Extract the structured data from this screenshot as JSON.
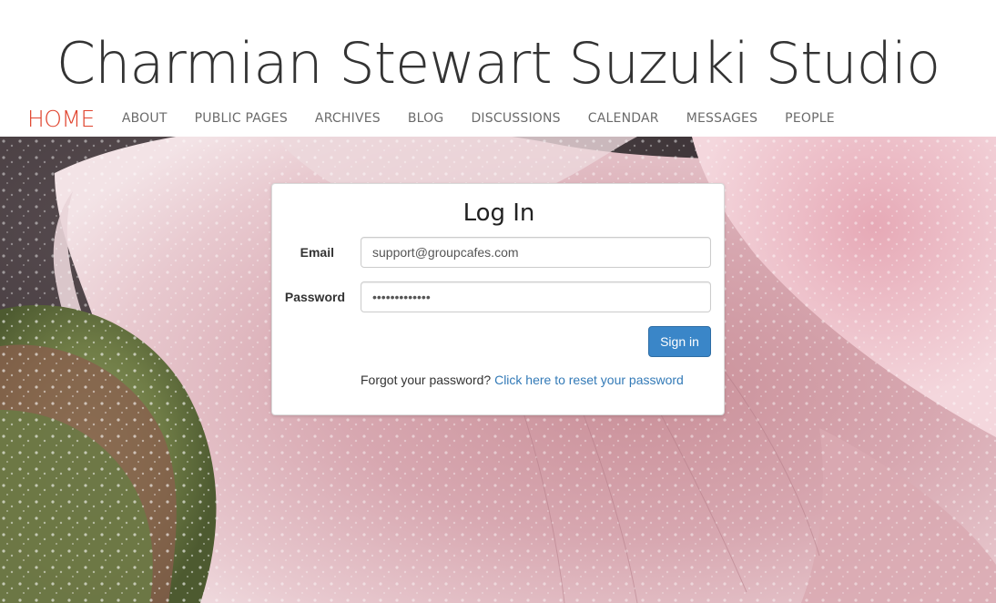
{
  "site": {
    "title": "Charmian Stewart Suzuki Studio"
  },
  "nav": {
    "items": [
      {
        "label": "HOME",
        "active": true
      },
      {
        "label": "ABOUT"
      },
      {
        "label": "PUBLIC PAGES"
      },
      {
        "label": "ARCHIVES"
      },
      {
        "label": "BLOG"
      },
      {
        "label": "DISCUSSIONS"
      },
      {
        "label": "CALENDAR"
      },
      {
        "label": "MESSAGES"
      },
      {
        "label": "PEOPLE"
      }
    ]
  },
  "login": {
    "title": "Log In",
    "email_label": "Email",
    "email_value": "support@groupcafes.com",
    "password_label": "Password",
    "password_value": "•••••••••••••",
    "signin_label": "Sign in",
    "forgot_text": "Forgot your password?",
    "reset_link": "Click here to reset your password"
  },
  "colors": {
    "accent_active_nav": "#e0432d",
    "button_primary": "#3a86c8",
    "link": "#337ab7"
  },
  "hero": {
    "image_description_icon": "frosted-flower-photo"
  }
}
